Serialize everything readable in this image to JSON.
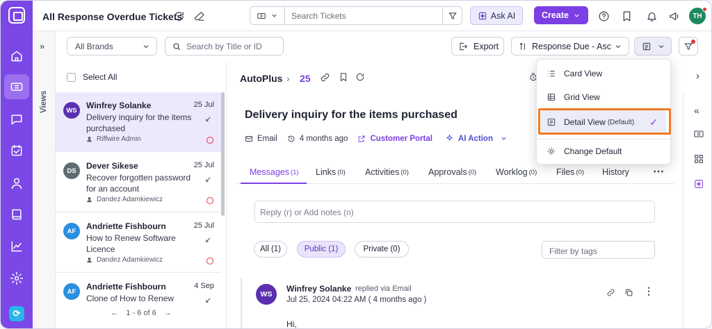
{
  "header": {
    "title": "All Response Overdue Tickets",
    "search_placeholder": "Search Tickets",
    "ask_ai_label": "Ask AI",
    "create_label": "Create",
    "user_initials": "TH"
  },
  "toolbar": {
    "brands_value": "All Brands",
    "title_search_placeholder": "Search by Title or ID",
    "export_label": "Export",
    "sort_label": "Response Due - Asc",
    "views_label": "Views"
  },
  "list": {
    "select_all_label": "Select All",
    "tickets": [
      {
        "initials": "WS",
        "avatar_color": "#5a2fb0",
        "name": "Winfrey Solanke",
        "date": "25 Jul",
        "subject": "Delivery inquiry for the items purchased",
        "agent": "Riffwire Admin"
      },
      {
        "initials": "DS",
        "avatar_color": "#5d6b72",
        "name": "Dever Sikese",
        "date": "25 Jul",
        "subject": "Recover forgotten password for an account",
        "agent": "Dandez Adamkiewicz"
      },
      {
        "initials": "AF",
        "avatar_color": "#2a8fe0",
        "name": "Andriette Fishbourn",
        "date": "25 Jul",
        "subject": "How to Renew Software Licence",
        "agent": "Dandez Adamkiewicz"
      },
      {
        "initials": "AF",
        "avatar_color": "#2a8fe0",
        "name": "Andriette Fishbourn",
        "date": "4 Sep",
        "subject": "Clone of How to Renew",
        "agent": ""
      }
    ],
    "pagination": "1 - 6 of 6"
  },
  "detail": {
    "brand": "AutoPlus",
    "ticket_number": "25",
    "subject": "Delivery inquiry for the items purchased",
    "channel": "Email",
    "age": "4 months ago",
    "portal_link": "Customer Portal",
    "ai_action": "AI Action",
    "tabs": [
      {
        "label": "Messages",
        "count": "(1)"
      },
      {
        "label": "Links",
        "count": "(0)"
      },
      {
        "label": "Activities",
        "count": "(0)"
      },
      {
        "label": "Approvals",
        "count": "(0)"
      },
      {
        "label": "Worklog",
        "count": "(0)"
      },
      {
        "label": "Files",
        "count": "(0)"
      },
      {
        "label": "History",
        "count": ""
      }
    ],
    "reply_placeholder": "Reply (r) or Add notes (n)",
    "filters": [
      {
        "label": "All (1)"
      },
      {
        "label": "Public (1)"
      },
      {
        "label": "Private (0)"
      }
    ],
    "tags_placeholder": "Filter by tags",
    "message": {
      "initials": "WS",
      "sender": "Winfrey Solanke",
      "via": "replied via Email",
      "timestamp": "Jul 25, 2024 04:22 AM ( 4 months ago )",
      "body_start": "Hi,"
    }
  },
  "view_menu": {
    "items": [
      {
        "label": "Card View",
        "icon": "list-icon"
      },
      {
        "label": "Grid View",
        "icon": "grid-icon"
      },
      {
        "label": "Detail View",
        "default_tag": "(Default)",
        "icon": "detail-view-icon",
        "selected": true
      },
      {
        "label": "Change Default",
        "icon": "gear-icon"
      }
    ]
  },
  "colors": {
    "brand": "#7b47e6",
    "accent": "#7b3fe4",
    "highlight": "#f07a22"
  }
}
